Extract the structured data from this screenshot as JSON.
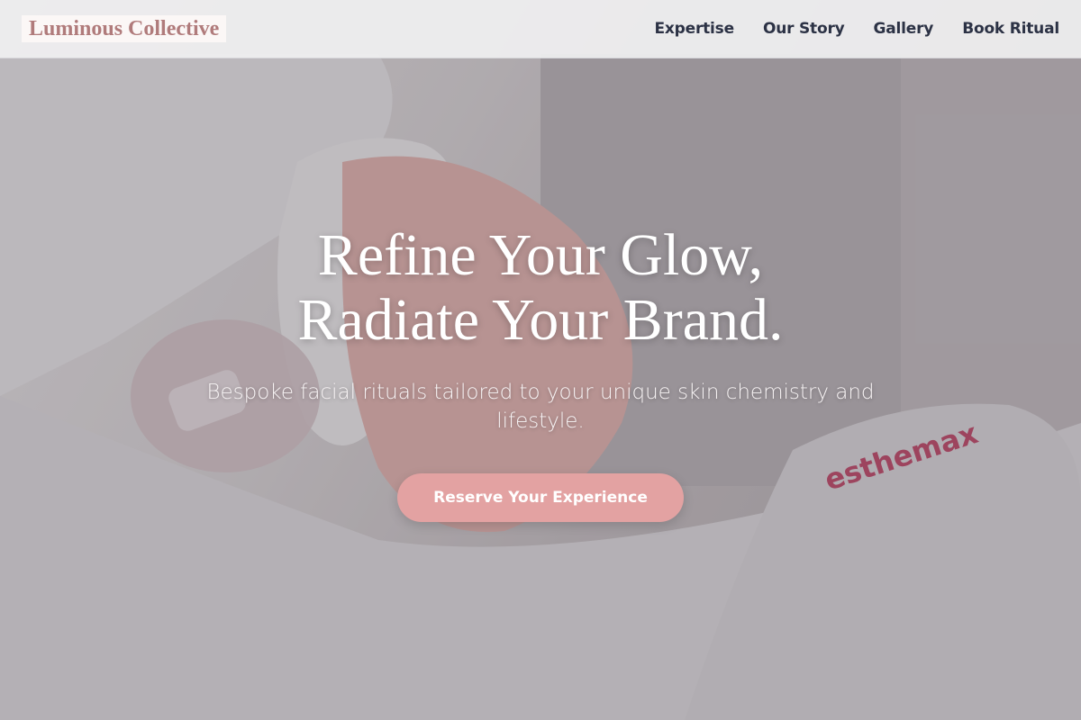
{
  "brand": {
    "name": "Luminous Collective"
  },
  "nav": {
    "items": [
      {
        "label": "Expertise"
      },
      {
        "label": "Our Story"
      },
      {
        "label": "Gallery"
      },
      {
        "label": "Book Ritual"
      }
    ]
  },
  "hero": {
    "headline_line1": "Refine Your Glow,",
    "headline_line2": "Radiate Your Brand.",
    "subtitle": "Bespoke facial rituals tailored to your unique skin chemistry and lifestyle.",
    "cta_label": "Reserve Your Experience",
    "towel_text": "esthemax"
  },
  "colors": {
    "brand": "#b07b7b",
    "cta": "#e3a2a2",
    "nav_text": "#2c3245"
  }
}
